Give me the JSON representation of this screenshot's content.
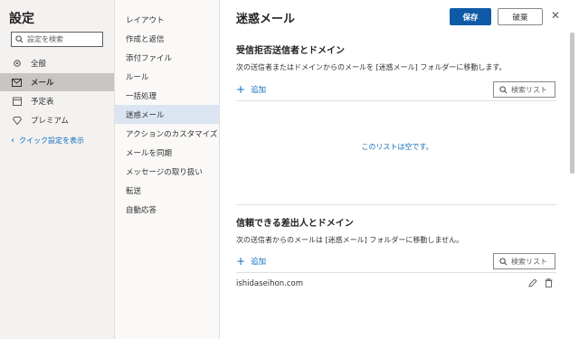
{
  "settings": {
    "title": "設定",
    "search_placeholder": "設定を検索",
    "nav": [
      {
        "label": "全般",
        "icon": "gear-icon"
      },
      {
        "label": "メール",
        "icon": "mail-icon"
      },
      {
        "label": "予定表",
        "icon": "calendar-icon"
      },
      {
        "label": "プレミアム",
        "icon": "diamond-icon"
      }
    ],
    "quick_settings": "クイック設定を表示"
  },
  "mail_menu": {
    "items": [
      "レイアウト",
      "作成と返信",
      "添付ファイル",
      "ルール",
      "一括処理",
      "迷惑メール",
      "アクションのカスタマイズ",
      "メールを同期",
      "メッセージの取り扱い",
      "転送",
      "自動応答"
    ],
    "selected": "迷惑メール"
  },
  "main": {
    "title": "迷惑メール",
    "save_label": "保存",
    "discard_label": "破棄",
    "blocked": {
      "heading": "受信拒否送信者とドメイン",
      "description": "次の送信者またはドメインからのメールを [迷惑メール] フォルダーに移動します。",
      "add_label": "追加",
      "search_label": "検索リスト",
      "empty_text": "このリストは空です。"
    },
    "safe": {
      "heading": "信頼できる差出人とドメイン",
      "description": "次の送信者からのメールは [迷惑メール] フォルダーに移動しません。",
      "add_label": "追加",
      "search_label": "検索リスト",
      "entries": [
        "ishidaseihon.com"
      ]
    }
  },
  "colors": {
    "accent": "#0f5aa6",
    "link": "#0f6cbd",
    "selected_nav": "#c8c6c4",
    "selected_menu": "#dbe5f1"
  }
}
